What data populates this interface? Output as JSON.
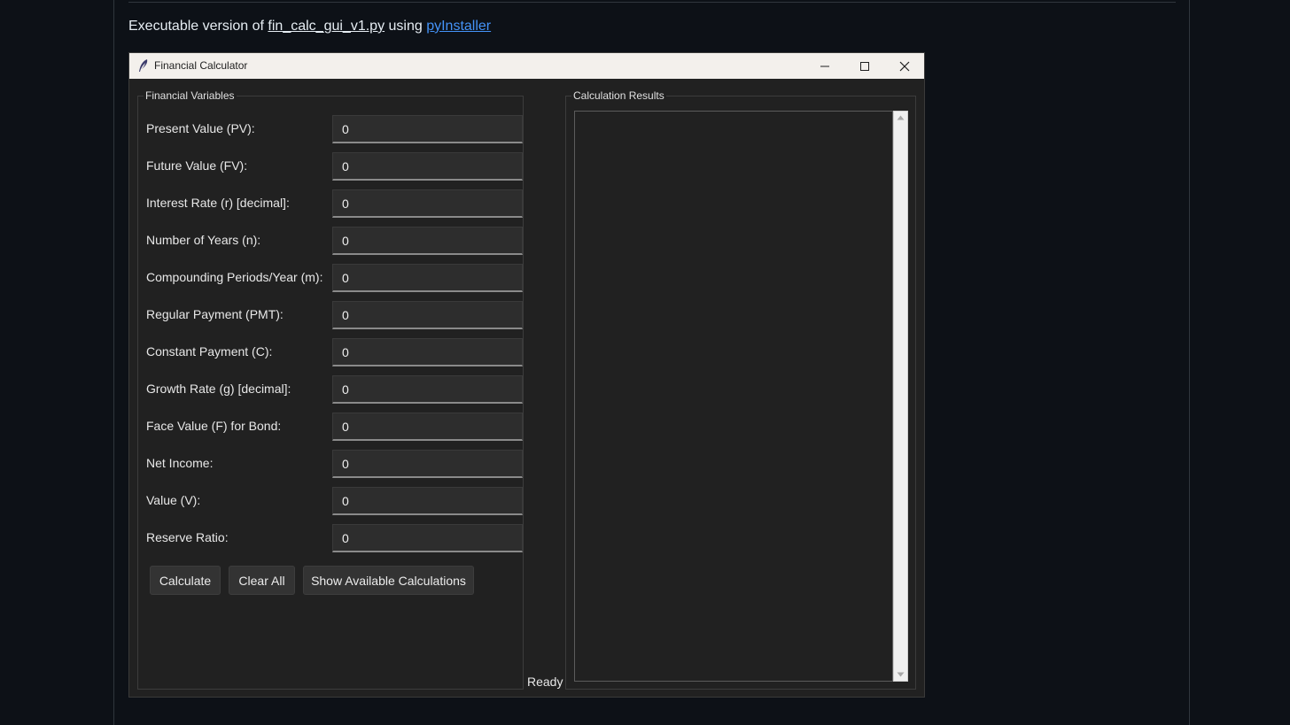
{
  "intro": {
    "prefix": "Executable version of ",
    "file_link": "fin_calc_gui_v1.py",
    "middle": " using ",
    "tool_link": "pyInstaller"
  },
  "window": {
    "title": "Financial Calculator",
    "minimize_icon": "minimize-icon",
    "maximize_icon": "maximize-icon",
    "close_icon": "close-icon",
    "app_icon": "feather-icon"
  },
  "variables": {
    "group_label": "Financial Variables",
    "fields": [
      {
        "label": "Present Value (PV):",
        "value": "0"
      },
      {
        "label": "Future Value (FV):",
        "value": "0"
      },
      {
        "label": "Interest Rate (r) [decimal]:",
        "value": "0"
      },
      {
        "label": "Number of Years (n):",
        "value": "0"
      },
      {
        "label": "Compounding Periods/Year (m):",
        "value": "0"
      },
      {
        "label": "Regular Payment (PMT):",
        "value": "0"
      },
      {
        "label": "Constant Payment (C):",
        "value": "0"
      },
      {
        "label": "Growth Rate (g) [decimal]:",
        "value": "0"
      },
      {
        "label": "Face Value (F) for Bond:",
        "value": "0"
      },
      {
        "label": "Net Income:",
        "value": "0"
      },
      {
        "label": "Value (V):",
        "value": "0"
      },
      {
        "label": "Reserve Ratio:",
        "value": "0"
      }
    ]
  },
  "buttons": {
    "calculate": "Calculate",
    "clear_all": "Clear All",
    "show_calculations": "Show Available Calculations"
  },
  "status": "Ready",
  "results": {
    "group_label": "Calculation Results",
    "text": ""
  },
  "colors": {
    "page_bg": "#0d1117",
    "window_bg": "#212121",
    "titlebar_bg": "#f3f0ec",
    "link": "#4493f8"
  }
}
